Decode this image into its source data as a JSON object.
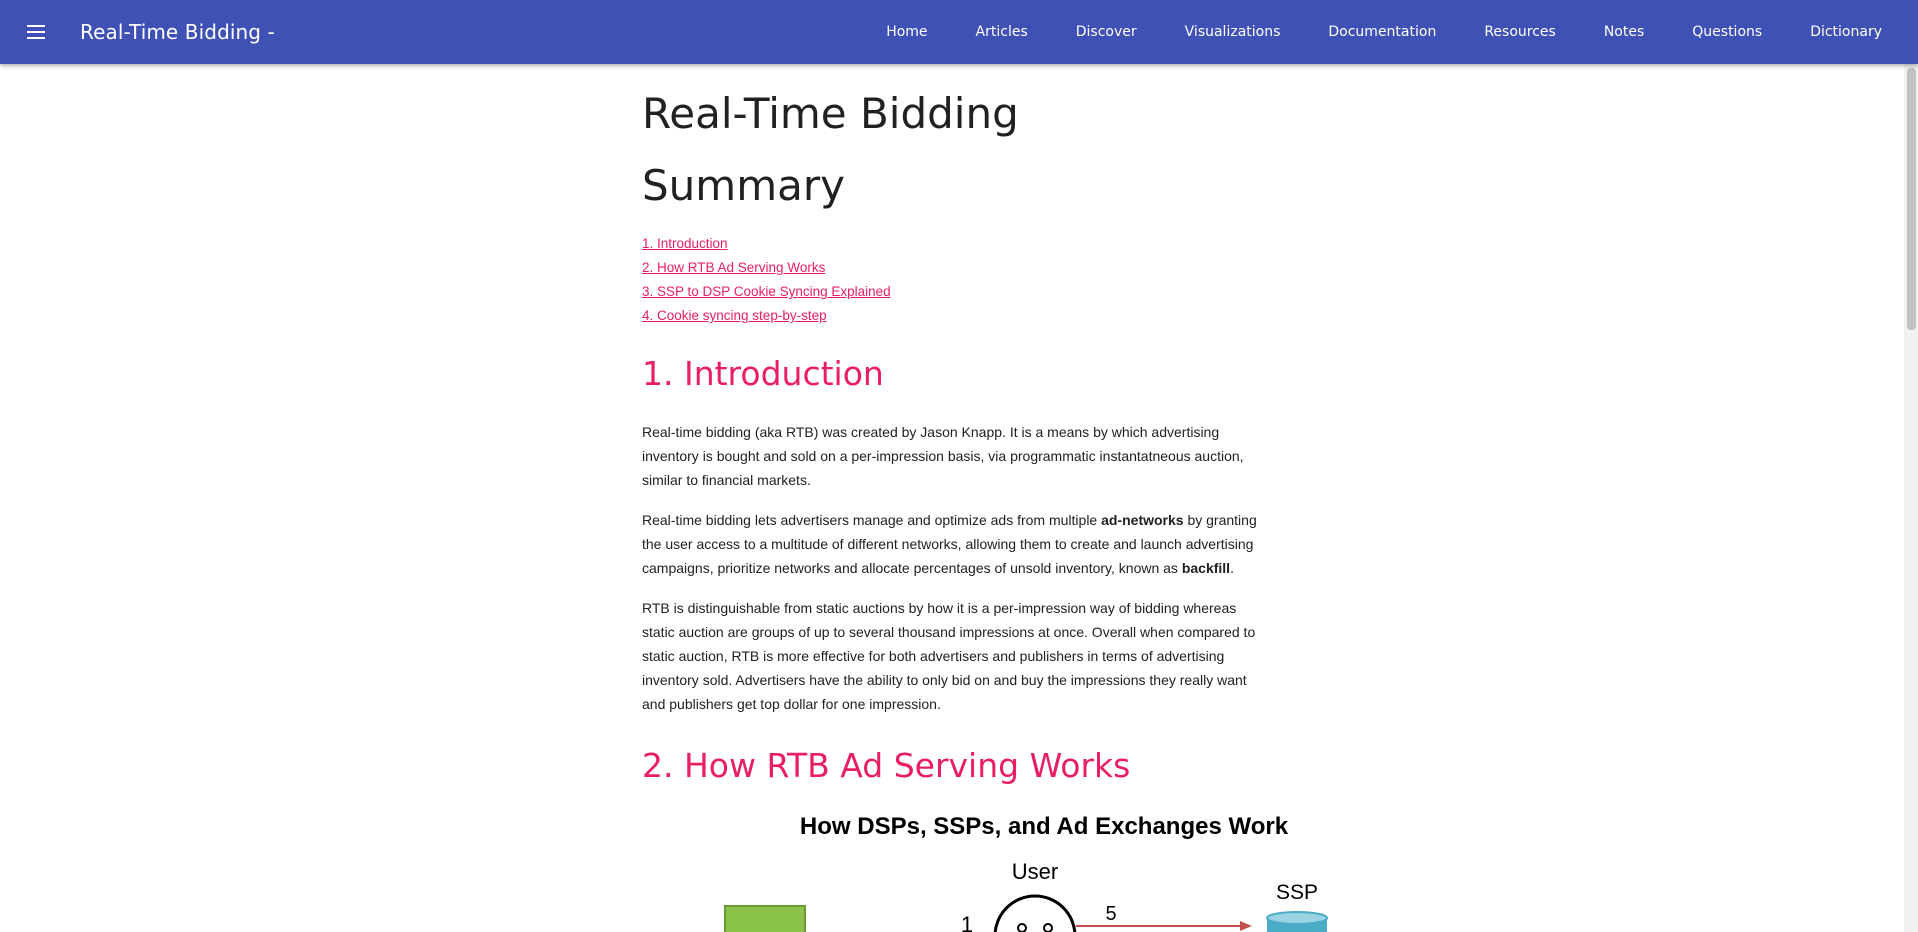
{
  "header": {
    "title": "Real-Time Bidding -",
    "nav": [
      "Home",
      "Articles",
      "Discover",
      "Visualizations",
      "Documentation",
      "Resources",
      "Notes",
      "Questions",
      "Dictionary"
    ]
  },
  "main": {
    "title": "Real-Time Bidding",
    "summary_title": "Summary",
    "toc": [
      "1. Introduction",
      "2. How RTB Ad Serving Works",
      "3. SSP to DSP Cookie Syncing Explained",
      "4. Cookie syncing step-by-step"
    ],
    "intro": {
      "heading": "1. Introduction",
      "p1": "Real-time bidding (aka RTB) was created by Jason Knapp. It is a means by which advertising inventory is bought and sold on a per-impression basis, via programmatic instantatneous auction, similar to financial markets.",
      "p2_a": "Real-time bidding lets advertisers manage and optimize ads from multiple ",
      "p2_b": "ad-networks",
      "p2_c": " by granting the user access to a multitude of different networks, allowing them to create and launch advertising campaigns, prioritize networks and allocate percentages of unsold inventory, known as ",
      "p2_d": "backfill",
      "p2_e": ".",
      "p3": "RTB is distinguishable from static auctions by how it is a per-impression way of bidding whereas static auction are groups of up to several thousand impressions at once. Overall when compared to static auction, RTB is more effective for both advertisers and publishers in terms of advertising inventory sold. Advertisers have the ability to only bid on and buy the impressions they really want and publishers get top dollar for one impression."
    },
    "how": {
      "heading": "2. How RTB Ad Serving Works",
      "diagram": {
        "title": "How DSPs, SSPs, and Ad Exchanges Work",
        "user_label": "User",
        "ssp_label": "SSP",
        "step_1": "1",
        "step_5": "5"
      }
    }
  },
  "colors": {
    "header": "#3f51b5",
    "accent": "#e91e63"
  },
  "icons": {
    "menu": "menu-icon"
  }
}
